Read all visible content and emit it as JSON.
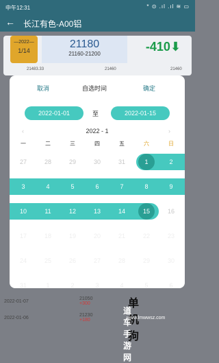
{
  "status": {
    "time": "中午12:31",
    "icons": "* ⊙ .ıl .ıl ≋ ▭"
  },
  "header": {
    "back": "←",
    "title": "长江有色-A00铝"
  },
  "card": {
    "badge_year": "—2022—",
    "badge_num": "1/14",
    "price": "21180",
    "range": "21160-21200",
    "change": "-410",
    "change_arrow": "⬇",
    "sub_left": "21483.33",
    "sub_mid": "21460",
    "sub_right": "21460"
  },
  "list": [
    {
      "date": "2022-01-07",
      "values": "21050",
      "delta": "+300"
    },
    {
      "date": "2022-01-06",
      "values": "21230",
      "delta": "+180"
    }
  ],
  "modal": {
    "cancel": "取消",
    "title": "自选时间",
    "ok": "确定",
    "start": "2022-01-01",
    "to": "至",
    "end": "2022-01-15",
    "month_label": "2022 - 1",
    "weekdays": [
      "一",
      "二",
      "三",
      "四",
      "五",
      "六",
      "日"
    ],
    "rows": [
      [
        "27",
        "28",
        "29",
        "30",
        "31",
        "1",
        "2"
      ],
      [
        "3",
        "4",
        "5",
        "6",
        "7",
        "8",
        "9"
      ],
      [
        "10",
        "11",
        "12",
        "13",
        "14",
        "15",
        "16"
      ],
      [
        "17",
        "18",
        "19",
        "20",
        "21",
        "22",
        "23"
      ],
      [
        "24",
        "25",
        "26",
        "27",
        "28",
        "29",
        "30"
      ],
      [
        "31",
        "1",
        "2",
        "3",
        "4",
        "5",
        "6"
      ]
    ]
  },
  "watermark": {
    "t1": "单机狗",
    "t2": "道车手游网",
    "t3": "www.lmwwsz.com"
  }
}
